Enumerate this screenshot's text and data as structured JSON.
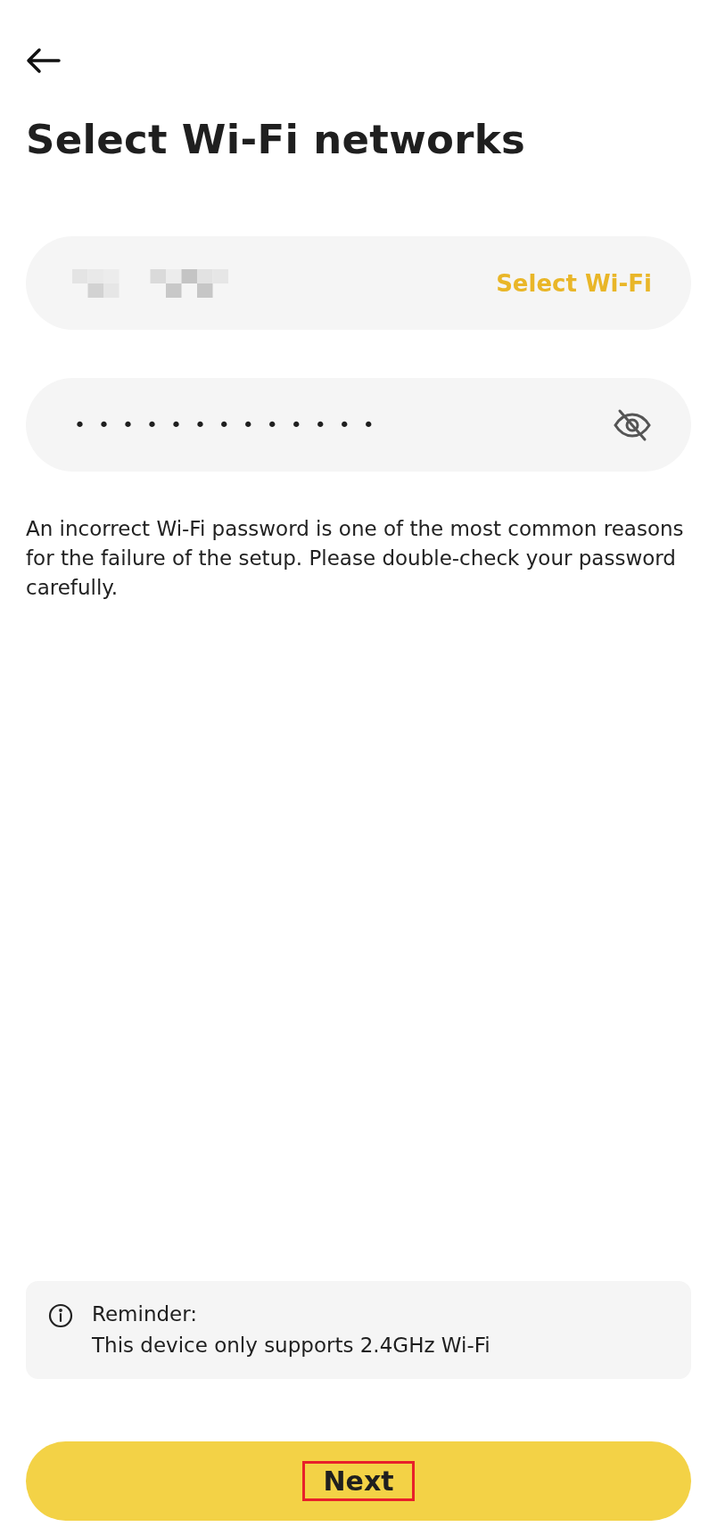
{
  "title": "Select Wi-Fi networks",
  "network_field": {
    "action": "Select Wi-Fi"
  },
  "password_field": {
    "value": "•••••••••••••",
    "visible": false
  },
  "note": "An incorrect Wi-Fi password is one of the most common reasons for the failure of the setup. Please double-check your password carefully.",
  "reminder": {
    "heading": "Reminder:",
    "text": "This device only supports 2.4GHz Wi-Fi"
  },
  "next_button": {
    "label": "Next",
    "highlighted": true
  }
}
